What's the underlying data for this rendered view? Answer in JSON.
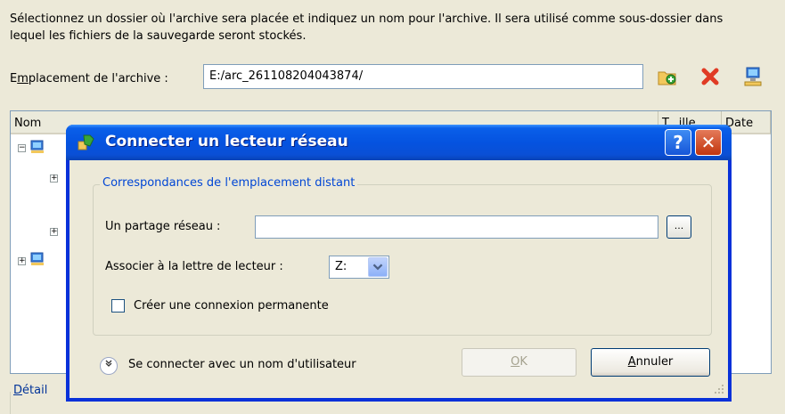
{
  "intro_text": "Sélectionnez un dossier où l'archive sera placée et indiquez un nom pour l'archive. Il sera utilisé comme sous-dossier dans lequel les fichiers de la sauvegarde seront stockés.",
  "location": {
    "label_prefix": "E",
    "label_accel": "m",
    "label_rest": "placement de l'archive :",
    "value": "E:/arc_261108204043874/"
  },
  "toolbar": {
    "new_folder_icon": "new-folder-icon",
    "delete_icon": "delete-icon",
    "map_drive_icon": "map-network-drive-icon"
  },
  "panel": {
    "columns": [
      "Nom",
      "T...ille",
      "Date"
    ]
  },
  "details": {
    "accel": "D",
    "rest": "étail"
  },
  "dialog": {
    "title": "Connecter un lecteur réseau",
    "help_glyph": "?",
    "close_glyph": "✕",
    "group_title": "Correspondances de l'emplacement distant",
    "share_label": "Un partage réseau :",
    "share_value": "",
    "browse_label": "...",
    "drive_label": "Associer à la lettre de lecteur :",
    "drive_value": "Z:",
    "permanent_label": "Créer une connexion permanente",
    "permanent_checked": false,
    "connect_user_label": "Se connecter avec un nom d'utilisateur",
    "ok_accel": "O",
    "ok_rest": "K",
    "cancel_accel": "A",
    "cancel_rest": "nnuler"
  },
  "colors": {
    "titlebar": "#0553e0",
    "window_bg": "#ece9d8",
    "group_title": "#0046d5"
  }
}
